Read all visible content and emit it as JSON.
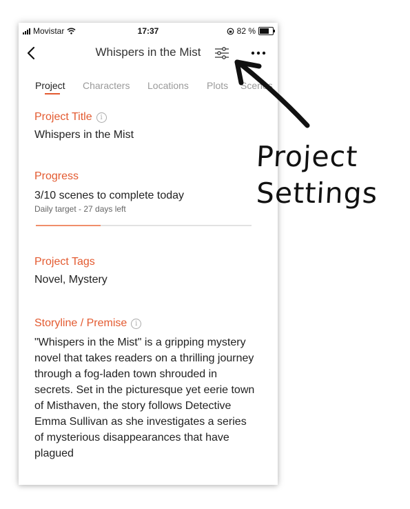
{
  "statusbar": {
    "carrier": "Movistar",
    "time": "17:37",
    "battery_text": "82 %",
    "battery_level": 0.82
  },
  "navbar": {
    "title": "Whispers in the Mist"
  },
  "tabs": [
    {
      "label": "Project",
      "active": true
    },
    {
      "label": "Characters",
      "active": false
    },
    {
      "label": "Locations",
      "active": false
    },
    {
      "label": "Plots",
      "active": false
    },
    {
      "label": "Scenes",
      "active": false
    }
  ],
  "project": {
    "title_label": "Project Title",
    "title_value": "Whispers in the Mist",
    "progress_label": "Progress",
    "progress_text": "3/10 scenes to complete today",
    "progress_sub": "Daily target - 27 days left",
    "progress_fraction": 0.3,
    "tags_label": "Project Tags",
    "tags_value": "Novel, Mystery",
    "story_label": "Storyline / Premise",
    "story_value": "\"Whispers in the Mist\" is a gripping mystery novel that takes readers on a thrilling journey through a fog-laden town shrouded in secrets. Set in the picturesque yet eerie town of Misthaven, the story follows Detective Emma Sullivan as she investigates a series of mysterious disappearances that have plagued"
  },
  "annotation": {
    "line1": "Project",
    "line2": "Settings"
  },
  "colors": {
    "accent": "#e35a30",
    "progress": "#f08e6a"
  }
}
